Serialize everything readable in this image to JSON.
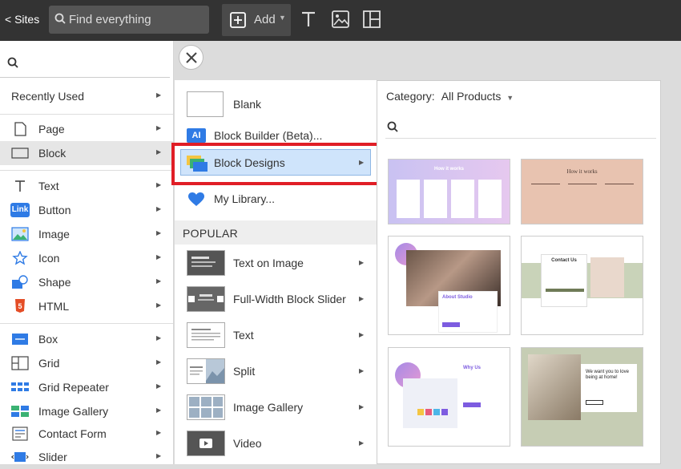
{
  "topbar": {
    "sites_label": "< Sites",
    "search_placeholder": "Find everything",
    "add_label": "Add"
  },
  "menu1": {
    "recent": "Recently Used",
    "items": [
      {
        "label": "Page",
        "icon": "page-icon"
      },
      {
        "label": "Block",
        "icon": "block-icon"
      },
      {
        "label": "Text",
        "icon": "text-icon"
      },
      {
        "label": "Button",
        "icon": "link-button-icon",
        "badge": "Link"
      },
      {
        "label": "Image",
        "icon": "image-icon"
      },
      {
        "label": "Icon",
        "icon": "star-icon"
      },
      {
        "label": "Shape",
        "icon": "shape-icon"
      },
      {
        "label": "HTML",
        "icon": "html5-icon",
        "badge": "5"
      },
      {
        "label": "Box",
        "icon": "box-icon"
      },
      {
        "label": "Grid",
        "icon": "grid-icon"
      },
      {
        "label": "Grid Repeater",
        "icon": "grid-repeater-icon"
      },
      {
        "label": "Image Gallery",
        "icon": "gallery-icon"
      },
      {
        "label": "Contact Form",
        "icon": "form-icon"
      },
      {
        "label": "Slider",
        "icon": "slider-icon"
      }
    ]
  },
  "menu2": {
    "blank": "Blank",
    "builder": "Block Builder (Beta)...",
    "builder_badge": "AI",
    "designs": "Block Designs",
    "library": "My Library...",
    "popular_header": "POPULAR",
    "popular": [
      "Text on Image",
      "Full-Width Block Slider",
      "Text",
      "Split",
      "Image Gallery",
      "Video"
    ]
  },
  "panel": {
    "category_label": "Category:",
    "category_value": "All Products",
    "cards": [
      {
        "heading": "How it works"
      },
      {
        "heading": "How it works"
      },
      {
        "heading": "About Studio"
      },
      {
        "heading": "Contact Us"
      },
      {
        "heading": "Why Us"
      },
      {
        "heading": "We want you to love being at home!"
      }
    ]
  },
  "colors": {
    "accent_red": "#e01e26",
    "highlight": "#cfe4fb",
    "topbar": "#333333"
  }
}
